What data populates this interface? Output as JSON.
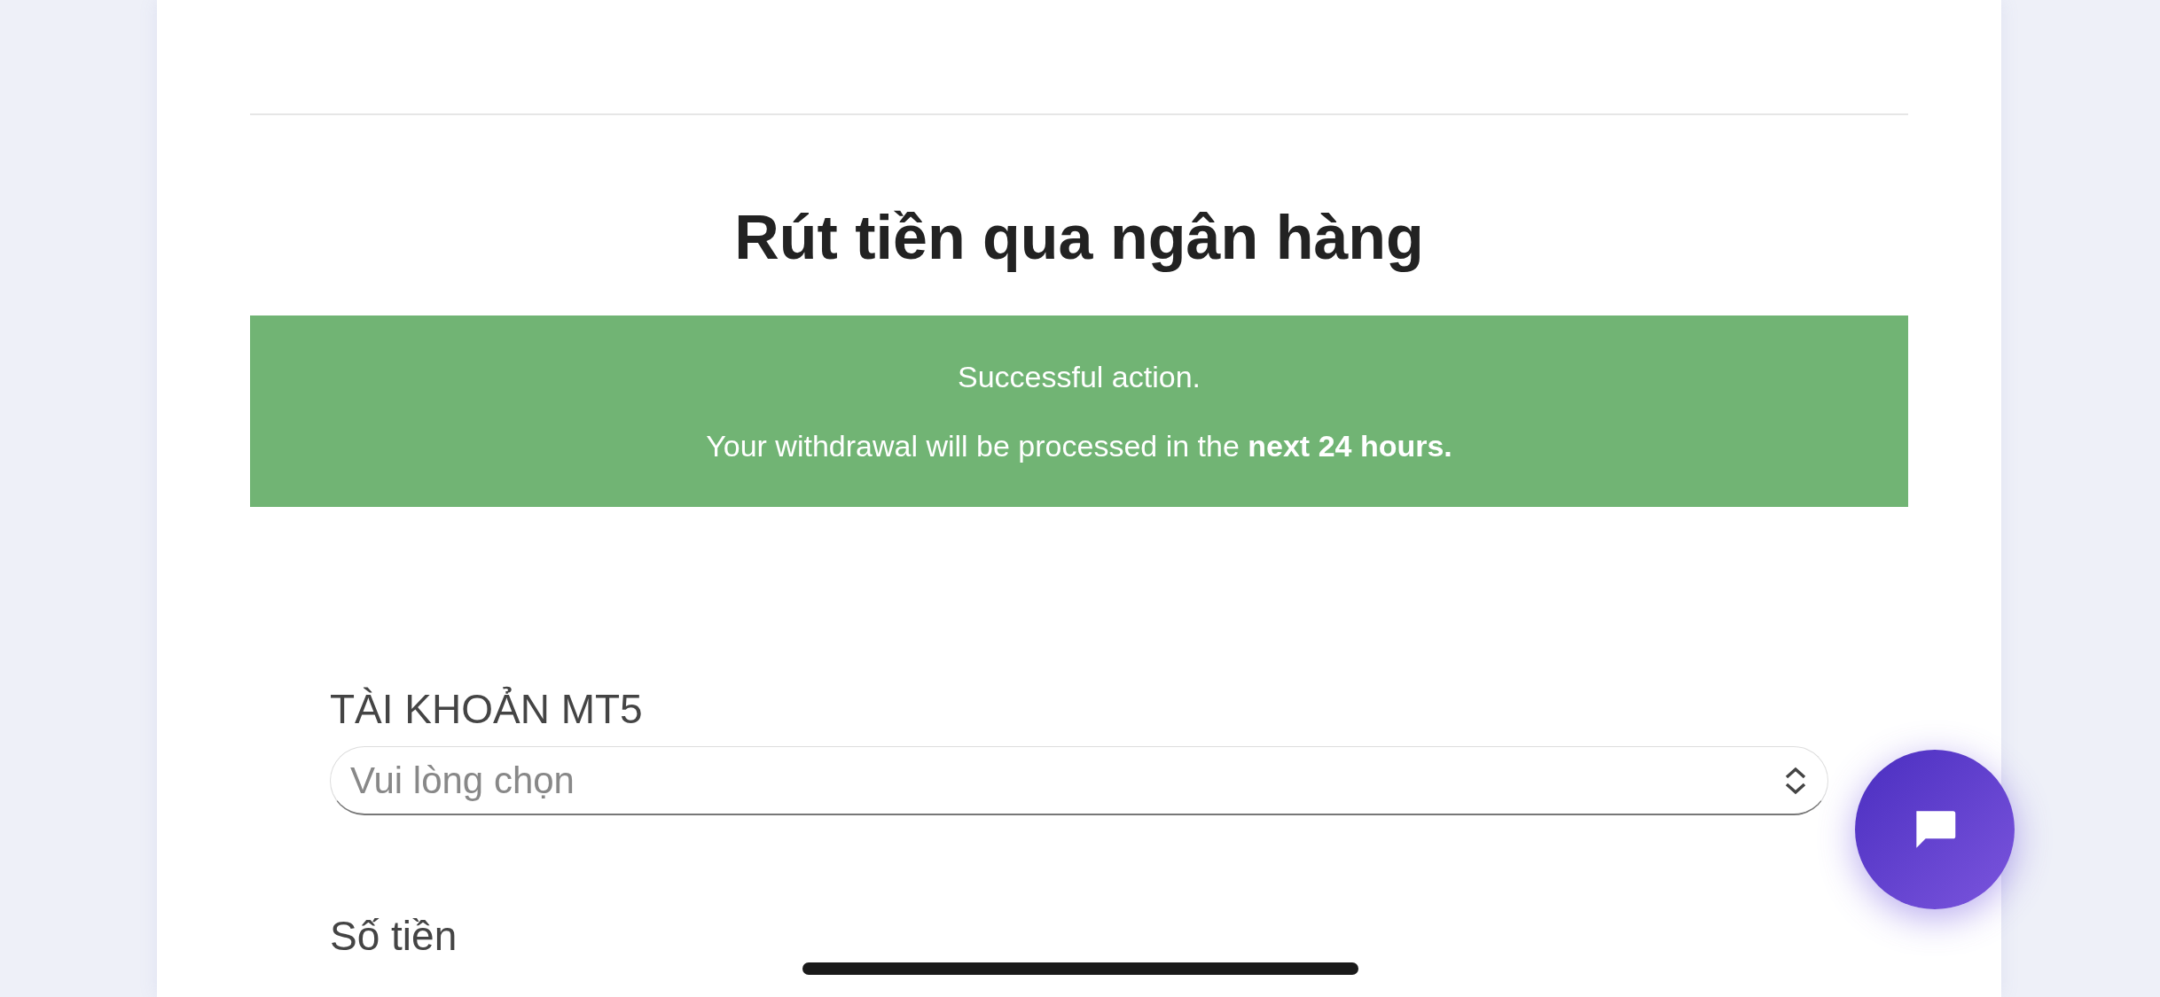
{
  "title": "Rút tiền qua ngân hàng",
  "alert": {
    "lines": [
      "Successful action.",
      "Your withdrawal will be processed in the **next 24 hours.**"
    ]
  },
  "fields": [
    {
      "kind": "select",
      "label": "TÀI KHOẢN MT5",
      "placeholder": "Vui lòng chọn"
    },
    {
      "kind": "label",
      "label": "Số tiền"
    }
  ]
}
